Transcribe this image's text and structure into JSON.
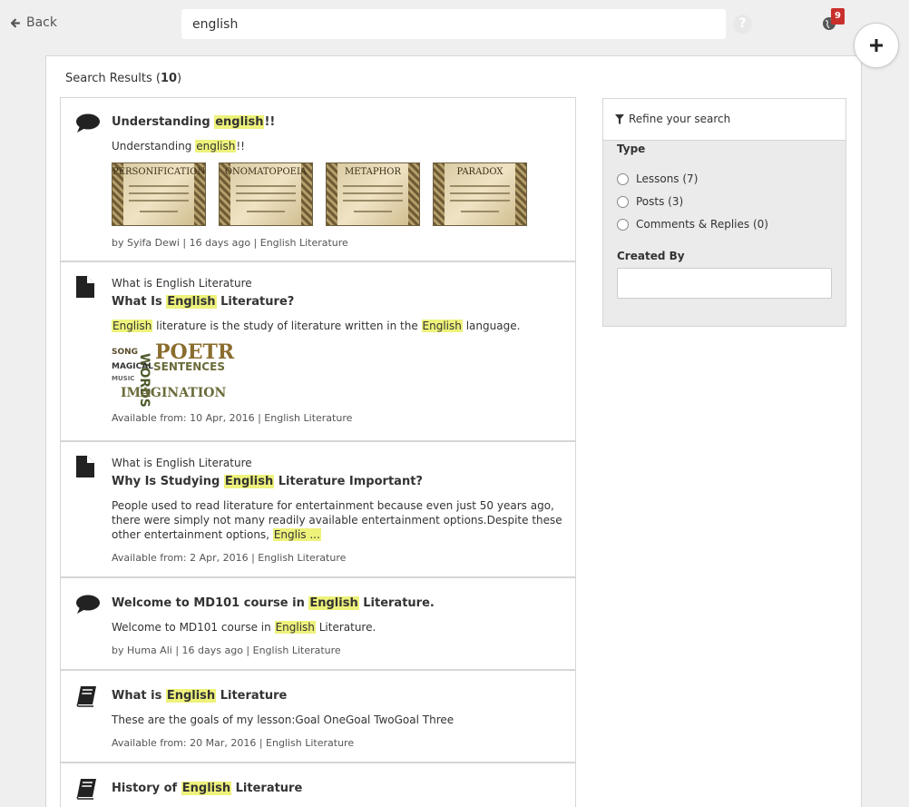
{
  "topbar": {
    "back_label": "Back",
    "search_value": "english",
    "help_glyph": "?",
    "notification_count": "9",
    "add_glyph": "+"
  },
  "results": {
    "label": "Search Results (",
    "count": "10",
    "label_end": ")"
  },
  "items": [
    {
      "icon": "comment-icon",
      "title_parts": [
        "Understanding ",
        "english",
        "!!"
      ],
      "desc_parts": [
        "Understanding ",
        "english",
        "!!"
      ],
      "images": [
        "PERSONIFICATION",
        "ONOMATOPOEIA",
        "METAPHOR",
        "PARADOX"
      ],
      "meta": "by Syifa Dewi | 16 days ago | English Literature"
    },
    {
      "icon": "document-icon",
      "crumb": "What is English Literature",
      "title_parts": [
        "What Is ",
        "English",
        " Literature?"
      ],
      "desc_parts": [
        "English",
        " literature is the study of literature written in the ",
        "English",
        " language."
      ],
      "cloud_words": [
        "POETR",
        "SENTENCES",
        "WORDS",
        "MAGICAL",
        "SONG",
        "MUSIC",
        "IMAGINATION"
      ],
      "meta": "Available from: 10 Apr, 2016 | English Literature"
    },
    {
      "icon": "document-icon",
      "crumb": "What is English Literature",
      "title_parts": [
        "Why Is Studying ",
        "English",
        " Literature Important?"
      ],
      "desc_parts": [
        "People used to read literature for entertainment because even just 50 years ago, there were simply not many readily available entertainment options.Despite these other entertainment options, ",
        "Englis ...",
        ""
      ],
      "meta": "Available from: 2 Apr, 2016 | English Literature"
    },
    {
      "icon": "comment-icon",
      "title_parts": [
        "Welcome to MD101 course in ",
        "English",
        " Literature."
      ],
      "desc_parts": [
        "Welcome to MD101 course in ",
        "English",
        " Literature."
      ],
      "meta": "by Huma Ali | 16 days ago | English Literature"
    },
    {
      "icon": "book-icon",
      "title_parts": [
        "What is ",
        "English",
        " Literature"
      ],
      "desc_parts": [
        "These are the goals of my lesson:Goal OneGoal TwoGoal Three"
      ],
      "meta": "Available from: 20 Mar, 2016 | English Literature"
    },
    {
      "icon": "book-icon",
      "title_parts": [
        "History of ",
        "English",
        " Literature"
      ]
    }
  ],
  "sidebar": {
    "heading": "Refine your search",
    "type_label": "Type",
    "options": [
      "Lessons (7)",
      "Posts (3)",
      "Comments & Replies (0)"
    ],
    "created_by_label": "Created By",
    "created_by_value": ""
  }
}
